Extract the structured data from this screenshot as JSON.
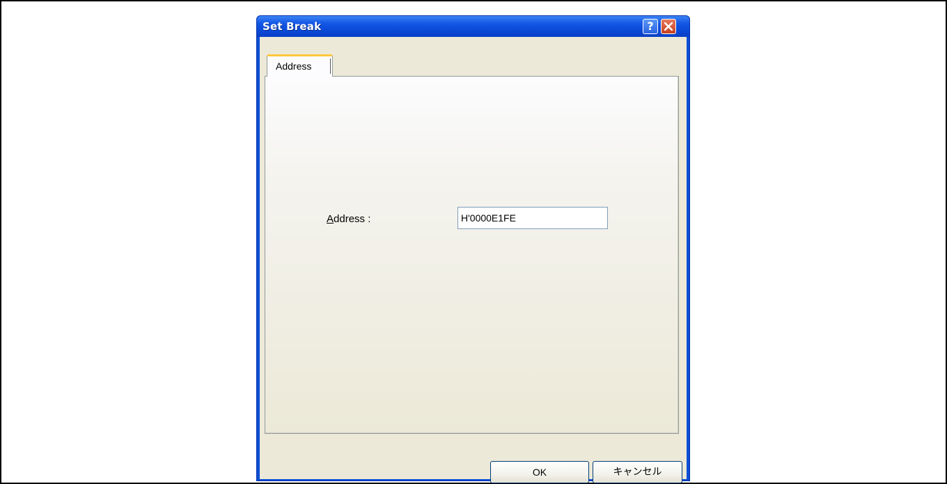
{
  "window": {
    "title": "Set Break",
    "help_label": "?"
  },
  "tabs": [
    {
      "label": "Address"
    }
  ],
  "form": {
    "address_label_hotkey": "A",
    "address_label_rest": "ddress :",
    "address_value": "H'0000E1FE"
  },
  "buttons": {
    "ok_label": "OK",
    "cancel_label": "キャンセル"
  },
  "colors": {
    "titlebar": "#0a49d6",
    "dialog_face": "#ece9d8",
    "close_button": "#c8401e",
    "tab_highlight": "#ffc83c"
  },
  "icons": {
    "help": "question-mark-icon",
    "close": "close-x-icon"
  }
}
